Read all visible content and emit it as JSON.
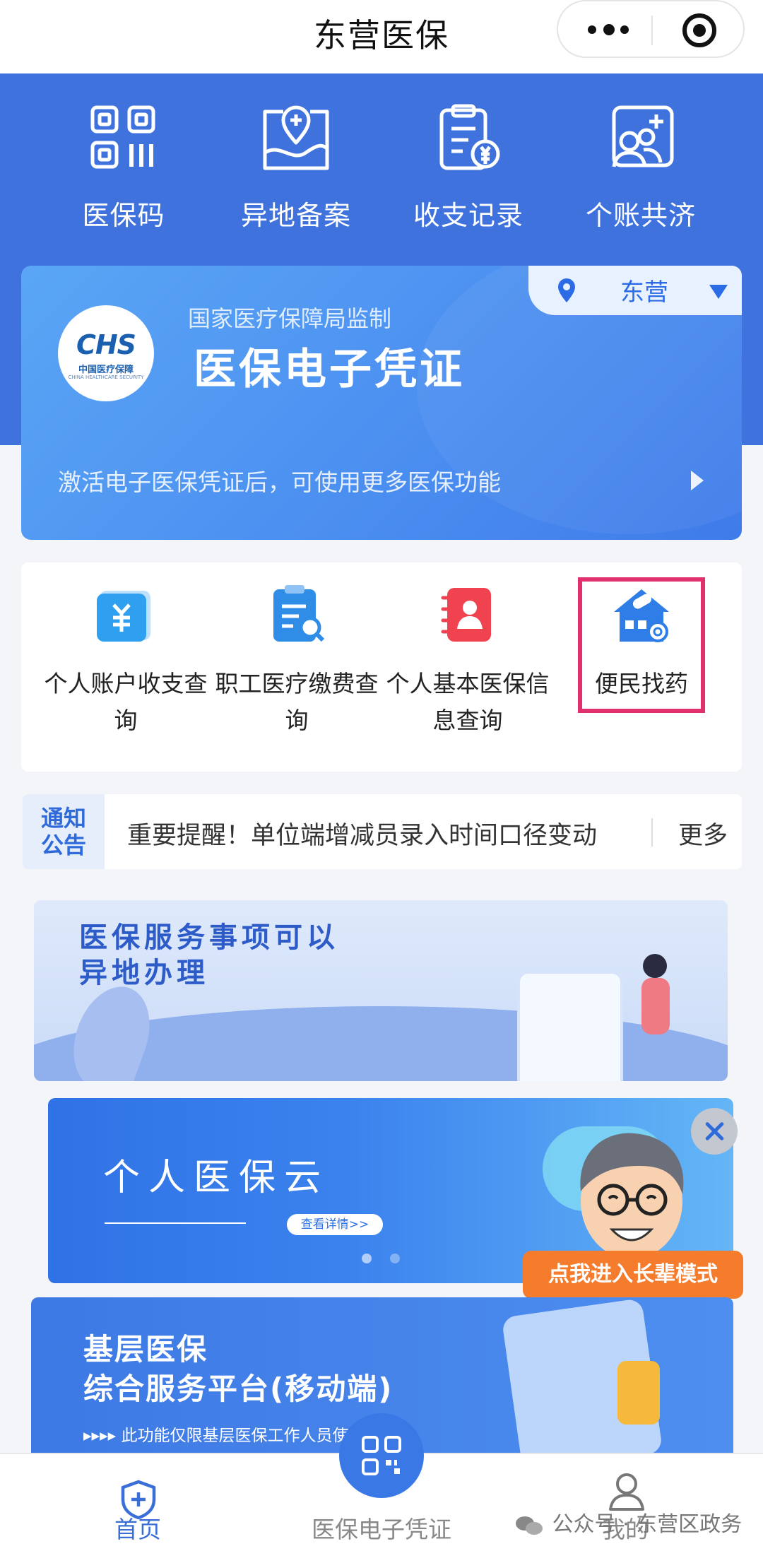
{
  "app": {
    "title": "东营医保"
  },
  "top_nav": [
    {
      "label": "医保码",
      "icon": "qr-code-icon"
    },
    {
      "label": "异地备案",
      "icon": "map-pin-icon"
    },
    {
      "label": "收支记录",
      "icon": "clipboard-yen-icon"
    },
    {
      "label": "个账共济",
      "icon": "users-add-icon"
    }
  ],
  "card": {
    "location": "东营",
    "logo_main": "CHS",
    "logo_sub": "中国医疗保障",
    "logo_en": "CHINA HEALTHCARE SECURITY",
    "supervisor": "国家医疗保障局监制",
    "title": "医保电子凭证",
    "note": "激活电子医保凭证后，可使用更多医保功能"
  },
  "services": [
    {
      "label": "个人账户收支查询",
      "icon": "yen-account-icon"
    },
    {
      "label": "职工医疗缴费查询",
      "icon": "document-search-icon"
    },
    {
      "label": "个人基本医保信息查询",
      "icon": "contact-book-icon"
    },
    {
      "label": "便民找药",
      "icon": "pharmacy-search-icon"
    }
  ],
  "notice": {
    "badge_line1": "通知",
    "badge_line2": "公告",
    "text": "重要提醒！单位端增减员录入时间口径变动",
    "more": "更多"
  },
  "banners": {
    "b1_line1": "医保服务事项可以",
    "b1_line2": "异地办理",
    "b2_title": "个人医保云",
    "b2_button": "查看详情>>",
    "b3_line1": "基层医保",
    "b3_line2": "综合服务平台(移动端)",
    "b3_sub": "▸▸▸▸ 此功能仅限基层医保工作人员使用"
  },
  "elder_mode": {
    "label": "点我进入长辈模式"
  },
  "tabs": [
    {
      "label": "首页",
      "active": true
    },
    {
      "label": "医保电子凭证",
      "active": false
    },
    {
      "label": "我的",
      "active": false
    }
  ],
  "watermark": "公众号 · 东营区政务",
  "colors": {
    "brand_blue": "#3f72dc",
    "highlight": "#e0306e",
    "elder_orange": "#f57c2c"
  }
}
